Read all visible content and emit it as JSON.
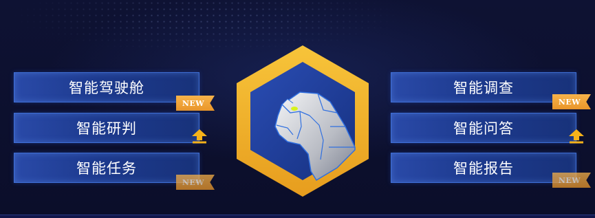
{
  "menu_left": [
    {
      "label": "智能驾驶舱",
      "badge": "NEW"
    },
    {
      "label": "智能研判",
      "badge": "up-arrow-icon"
    },
    {
      "label": "智能任务",
      "badge": "NEW"
    }
  ],
  "menu_right": [
    {
      "label": "智能调查",
      "badge": "NEW"
    },
    {
      "label": "智能问答",
      "badge": "up-arrow-icon"
    },
    {
      "label": "智能报告",
      "badge": "NEW"
    }
  ],
  "center_logo": {
    "icon": "leopard-head-icon",
    "frame_color": "#f3b32a",
    "inner_color": "#1f3d9a"
  },
  "colors": {
    "background": "#0c0f2b",
    "button": "#1d3a8e",
    "button_border": "#3e6fd6",
    "badge": "#f0a23a"
  }
}
